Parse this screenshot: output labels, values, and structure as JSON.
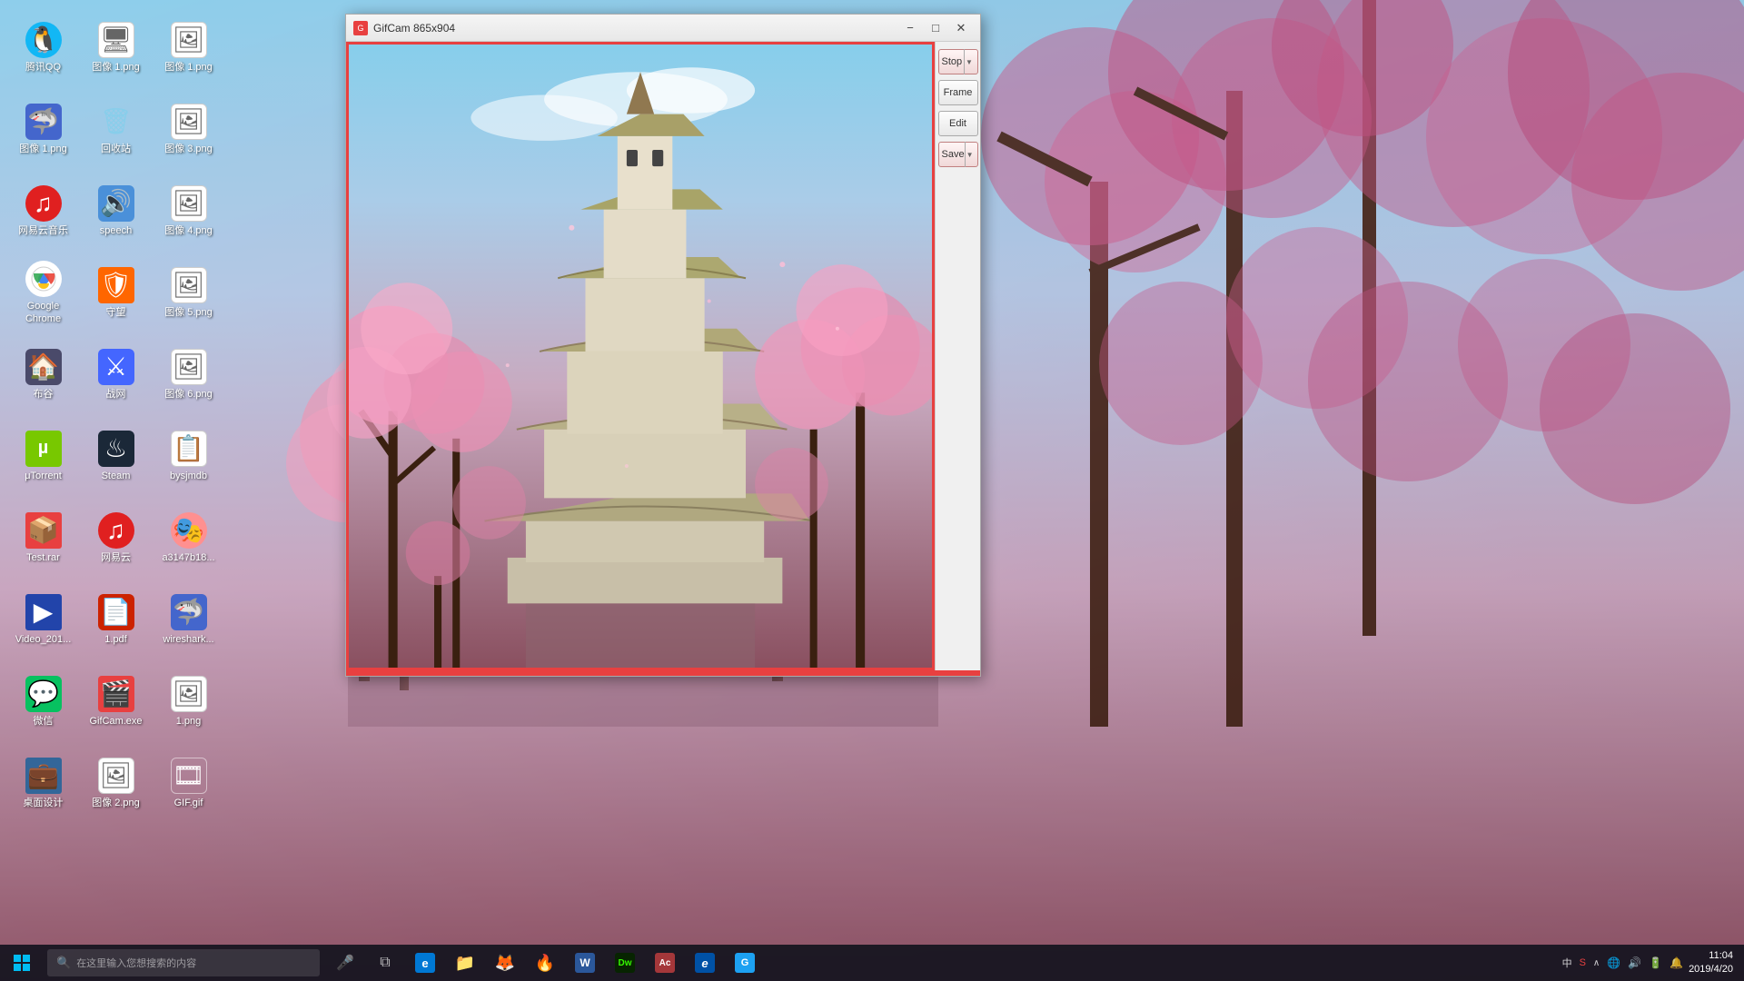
{
  "window": {
    "title": "GifCam 865x904",
    "minimize_label": "−",
    "restore_label": "□",
    "close_label": "✕",
    "icon_color": "#e84040"
  },
  "gifcam": {
    "buttons": {
      "stop": "Stop",
      "frame": "Frame",
      "edit": "Edit",
      "save": "Save"
    }
  },
  "desktop_icons": [
    {
      "id": "qq",
      "label": "腾讯QQ",
      "icon": "🐧",
      "style": "icon-qq"
    },
    {
      "id": "laptop",
      "label": "图像 1.png",
      "icon": "🖥",
      "style": "icon-file"
    },
    {
      "id": "image1",
      "label": "图像 1.png",
      "icon": "🖼",
      "style": "icon-file"
    },
    {
      "id": "wireshark",
      "label": "Wireshark",
      "icon": "🦈",
      "style": "icon-wireshark"
    },
    {
      "id": "recycle",
      "label": "回收站",
      "icon": "🗑",
      "style": "icon-recycle"
    },
    {
      "id": "image3",
      "label": "图像 3.png",
      "icon": "🖼",
      "style": "icon-file"
    },
    {
      "id": "netease",
      "label": "网易云音乐",
      "icon": "♫",
      "style": "icon-netease"
    },
    {
      "id": "speech",
      "label": "speech",
      "icon": "🔊",
      "style": "icon-speech"
    },
    {
      "id": "image4",
      "label": "图像 4.png",
      "icon": "🖼",
      "style": "icon-file"
    },
    {
      "id": "chrome",
      "label": "Google Chrome",
      "icon": "◎",
      "style": "icon-chrome"
    },
    {
      "id": "shield",
      "label": "守望",
      "icon": "🛡",
      "style": "icon-shield"
    },
    {
      "id": "image5",
      "label": "图像 5.png",
      "icon": "🖼",
      "style": "icon-file"
    },
    {
      "id": "desktop",
      "label": "布谷",
      "icon": "🏠",
      "style": "icon-desktop"
    },
    {
      "id": "zhangwang",
      "label": "战网",
      "icon": "⚔",
      "style": "icon-zhangwang"
    },
    {
      "id": "image6",
      "label": "图像 6.png",
      "icon": "🖼",
      "style": "icon-file"
    },
    {
      "id": "utorrent",
      "label": "μTorrent",
      "icon": "µ",
      "style": "icon-utorrent"
    },
    {
      "id": "steam",
      "label": "Steam",
      "icon": "♨",
      "style": "icon-steam"
    },
    {
      "id": "bysjmdb",
      "label": "bysjmdb",
      "icon": "📋",
      "style": "icon-file"
    },
    {
      "id": "testrar",
      "label": "Test.rar",
      "icon": "📦",
      "style": "icon-testrar"
    },
    {
      "id": "netease2",
      "label": "网易云",
      "icon": "♫",
      "style": "icon-netease"
    },
    {
      "id": "anime",
      "label": "a3147b18...",
      "icon": "🎭",
      "style": "icon-anime"
    },
    {
      "id": "video",
      "label": "Video_201...",
      "icon": "▶",
      "style": "icon-video"
    },
    {
      "id": "pdf1",
      "label": "1.pdf",
      "icon": "📄",
      "style": "icon-pdf"
    },
    {
      "id": "ws2",
      "label": "wireshark...",
      "icon": "🦈",
      "style": "icon-ws2"
    },
    {
      "id": "wechat",
      "label": "微信",
      "icon": "💬",
      "style": "icon-wechat"
    },
    {
      "id": "gifcam",
      "label": "GifCam.exe",
      "icon": "🎬",
      "style": "icon-gifcam"
    },
    {
      "id": "img1",
      "label": "1.png",
      "icon": "🖼",
      "style": "icon-file"
    },
    {
      "id": "anjian",
      "label": "桌面设计",
      "icon": "💼",
      "style": "icon-anjian"
    },
    {
      "id": "image2",
      "label": "图像 2.png",
      "icon": "🖼",
      "style": "icon-file"
    },
    {
      "id": "giffile",
      "label": "GIF.gif",
      "icon": "🎞",
      "style": "icon-gif"
    }
  ],
  "taskbar": {
    "search_placeholder": "在这里输入您想搜索的内容",
    "time": "11:04",
    "date": "2019/4/20",
    "taskbar_apps": [
      {
        "id": "start",
        "icon": "⊞",
        "label": "Start"
      },
      {
        "id": "search",
        "label": "search"
      },
      {
        "id": "cortana",
        "icon": "○",
        "label": "Cortana"
      },
      {
        "id": "taskview",
        "icon": "⧉",
        "label": "Task View"
      },
      {
        "id": "edge-tb",
        "icon": "e",
        "label": "Edge"
      },
      {
        "id": "folder",
        "icon": "📁",
        "label": "File Explorer"
      },
      {
        "id": "firefox",
        "icon": "🦊",
        "label": "Firefox"
      },
      {
        "id": "word",
        "icon": "W",
        "label": "Word"
      },
      {
        "id": "dreamweaver",
        "icon": "Dw",
        "label": "Dreamweaver"
      },
      {
        "id": "access",
        "icon": "Ac",
        "label": "Access"
      },
      {
        "id": "ie",
        "icon": "e",
        "label": "Internet Explorer"
      },
      {
        "id": "gyazo",
        "icon": "G",
        "label": "Gyazo"
      }
    ]
  }
}
